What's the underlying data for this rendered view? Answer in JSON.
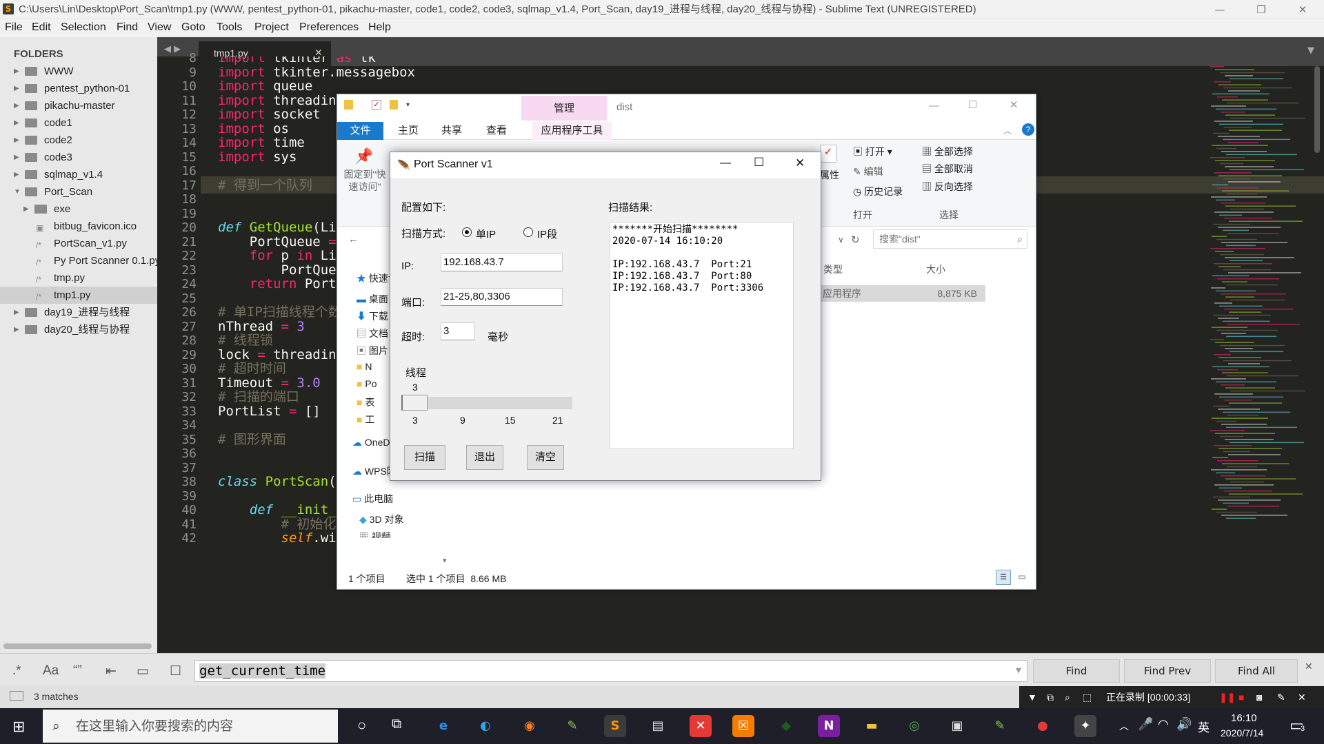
{
  "window": {
    "title": "C:\\Users\\Lin\\Desktop\\Port_Scan\\tmp1.py (WWW, pentest_python-01, pikachu-master, code1, code2, code3, sqlmap_v1.4, Port_Scan, day19_进程与线程, day20_线程与协程) - Sublime Text (UNREGISTERED)"
  },
  "menu": [
    "File",
    "Edit",
    "Selection",
    "Find",
    "View",
    "Goto",
    "Tools",
    "Project",
    "Preferences",
    "Help"
  ],
  "sidebar": {
    "title": "FOLDERS",
    "items": [
      "WWW",
      "pentest_python-01",
      "pikachu-master",
      "code1",
      "code2",
      "code3",
      "sqlmap_v1.4",
      "Port_Scan",
      "exe",
      "bitbug_favicon.ico",
      "PortScan_v1.py",
      "Py Port Scanner 0.1.py",
      "tmp.py",
      "tmp1.py",
      "day19_进程与线程",
      "day20_线程与协程"
    ]
  },
  "editor": {
    "tab": "tmp1.py",
    "lines": [
      {
        "n": "8",
        "t": "import tkinter as tk"
      },
      {
        "n": "9",
        "t": "import tkinter.messagebox"
      },
      {
        "n": "10",
        "t": "import queue"
      },
      {
        "n": "11",
        "t": "import threading"
      },
      {
        "n": "12",
        "t": "import socket"
      },
      {
        "n": "13",
        "t": "import os"
      },
      {
        "n": "14",
        "t": "import time"
      },
      {
        "n": "15",
        "t": "import sys"
      },
      {
        "n": "16",
        "t": ""
      },
      {
        "n": "17",
        "t": "# 得到一个队列"
      },
      {
        "n": "18",
        "t": ""
      },
      {
        "n": "19",
        "t": ""
      },
      {
        "n": "20",
        "t": "def GetQueue(List):"
      },
      {
        "n": "21",
        "t": "    PortQueue = queue.Queue()"
      },
      {
        "n": "22",
        "t": "    for p in List:"
      },
      {
        "n": "23",
        "t": "        PortQueue.put(p)"
      },
      {
        "n": "24",
        "t": "    return PortQueue"
      },
      {
        "n": "25",
        "t": ""
      },
      {
        "n": "26",
        "t": "# 单IP扫描线程个数"
      },
      {
        "n": "27",
        "t": "nThread = 3"
      },
      {
        "n": "28",
        "t": "# 线程锁"
      },
      {
        "n": "29",
        "t": "lock = threading.Lock()"
      },
      {
        "n": "30",
        "t": "# 超时时间"
      },
      {
        "n": "31",
        "t": "Timeout = 3.0"
      },
      {
        "n": "32",
        "t": "# 扫描的端口"
      },
      {
        "n": "33",
        "t": "PortList = []"
      },
      {
        "n": "34",
        "t": ""
      },
      {
        "n": "35",
        "t": "# 图形界面"
      },
      {
        "n": "36",
        "t": ""
      },
      {
        "n": "37",
        "t": ""
      },
      {
        "n": "38",
        "t": "class PortScan(object):"
      },
      {
        "n": "39",
        "t": ""
      },
      {
        "n": "40",
        "t": "    def __init__(self):"
      },
      {
        "n": "41",
        "t": "        # 初始化一个窗口实例"
      },
      {
        "n": "42",
        "t": "        self.window = tk.Tk()  # 初始化一个窗口实例"
      }
    ]
  },
  "explorer": {
    "title": "dist",
    "context_tab": "管理",
    "tabs": [
      "文件",
      "主页",
      "共享",
      "查看",
      "应用程序工具"
    ],
    "ribbon": {
      "pin": "固定到\"快速访问\"",
      "props": "属性",
      "open_group": [
        "打开",
        "编辑",
        "历史记录"
      ],
      "open_label": "打开",
      "select_group": [
        "全部选择",
        "全部取消",
        "反向选择"
      ],
      "select_label": "选择"
    },
    "search_placeholder": "搜索\"dist\"",
    "columns": [
      "类型",
      "大小"
    ],
    "file_row": {
      "type": "应用程序",
      "size": "8,875 KB"
    },
    "nav": [
      "快速访问",
      "桌面",
      "下载",
      "文档",
      "图片",
      "N",
      "Po",
      "表",
      "工",
      "OneDrive",
      "WPS网盘",
      "此电脑",
      "3D 对象",
      "视频"
    ],
    "status": [
      "1 个项目",
      "选中 1 个项目  8.66 MB"
    ]
  },
  "scanner": {
    "title": "Port Scanner v1",
    "config_label": "配置如下:",
    "mode_label": "扫描方式:",
    "mode_single": "单IP",
    "mode_range": "IP段",
    "ip_label": "IP:",
    "ip_value": "192.168.43.7",
    "port_label": "端口:",
    "port_value": "21-25,80,3306",
    "timeout_label": "超时:",
    "timeout_value": "3",
    "timeout_unit": "毫秒",
    "thread_label": "线程",
    "thread_value": "3",
    "thread_slider_fraction": 0.0,
    "thread_ticks": [
      "3",
      "9",
      "15",
      "21"
    ],
    "buttons": {
      "scan": "扫描",
      "exit": "退出",
      "clear": "清空"
    },
    "result_label": "扫描结果:",
    "results": "*******开始扫描********\n2020-07-14 16:10:20\n\nIP:192.168.43.7  Port:21\nIP:192.168.43.7  Port:80\nIP:192.168.43.7  Port:3306"
  },
  "find": {
    "query": "get_current_time",
    "find": "Find",
    "find_prev": "Find Prev",
    "find_all": "Find All"
  },
  "status": {
    "matches": "3 matches",
    "recording": "正在录制 [00:00:33]"
  },
  "taskbar": {
    "search": "在这里输入你要搜索的内容",
    "time": "16:10",
    "date": "2020/7/14",
    "lang": "英",
    "notif": "3"
  }
}
